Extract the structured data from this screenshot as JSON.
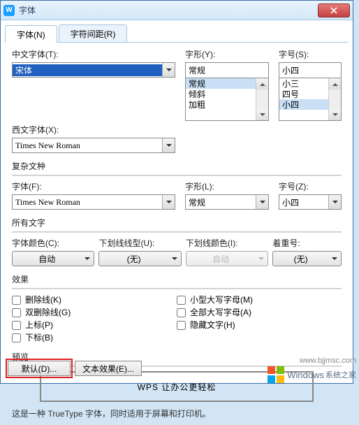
{
  "window": {
    "title": "字体"
  },
  "tabs": {
    "font": "字体(N)",
    "spacing": "字符间距(R)"
  },
  "section1": {
    "cn_font_label": "中文字体(T):",
    "cn_font_value": "宋体",
    "style_label": "字形(Y):",
    "style_value": "常规",
    "style_options": [
      "常规",
      "倾斜",
      "加粗"
    ],
    "size_label": "字号(S):",
    "size_value": "小四",
    "size_options": [
      "小三",
      "四号",
      "小四"
    ],
    "en_font_label": "西文字体(X):",
    "en_font_value": "Times New Roman"
  },
  "section2": {
    "title": "复杂文种",
    "font_label": "字体(F):",
    "font_value": "Times New Roman",
    "style_label": "字形(L):",
    "style_value": "常规",
    "size_label": "字号(Z):",
    "size_value": "小四"
  },
  "section3": {
    "title": "所有文字",
    "color_label": "字体颜色(C):",
    "color_value": "自动",
    "underline_label": "下划线线型(U):",
    "underline_value": "(无)",
    "ul_color_label": "下划线颜色(I):",
    "ul_color_value": "自动",
    "emphasis_label": "着重号:",
    "emphasis_value": "(无)"
  },
  "effects": {
    "title": "效果",
    "strike": "删除线(K)",
    "dblstrike": "双删除线(G)",
    "superscript": "上标(P)",
    "subscript": "下标(B)",
    "smallcaps": "小型大写字母(M)",
    "allcaps": "全部大写字母(A)",
    "hidden": "隐藏文字(H)"
  },
  "preview": {
    "title": "预览",
    "text": "WPS 让办公更轻松",
    "note": "这是一种  TrueType  字体，同时适用于屏幕和打印机。"
  },
  "buttons": {
    "default": "默认(D)...",
    "texteffect": "文本效果(E)..."
  },
  "watermark": {
    "url": "www.bjjmsc.com",
    "brand1": "Windows",
    "brand2": "系统之家"
  }
}
